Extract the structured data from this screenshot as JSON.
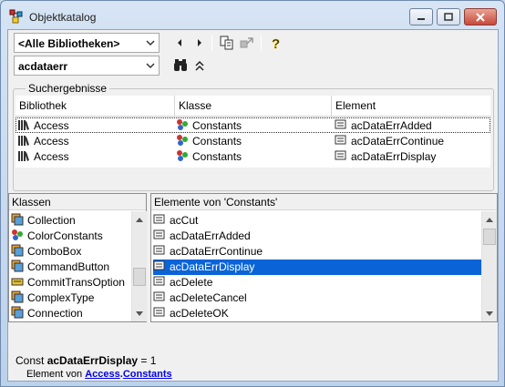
{
  "window": {
    "title": "Objektkatalog"
  },
  "toolbar": {
    "library_value": "<Alle Bibliotheken>",
    "search_value": "acdataerr"
  },
  "results": {
    "group_label": "Suchergebnisse",
    "columns": [
      "Bibliothek",
      "Klasse",
      "Element"
    ],
    "rows": [
      {
        "library": "Access",
        "class": "Constants",
        "element": "acDataErrAdded"
      },
      {
        "library": "Access",
        "class": "Constants",
        "element": "acDataErrContinue"
      },
      {
        "library": "Access",
        "class": "Constants",
        "element": "acDataErrDisplay"
      }
    ]
  },
  "classes": {
    "header": "Klassen",
    "items": [
      "Collection",
      "ColorConstants",
      "ComboBox",
      "CommandButton",
      "CommitTransOption",
      "ComplexType",
      "Connection"
    ]
  },
  "members": {
    "header": "Elemente von 'Constants'",
    "items": [
      "acCut",
      "acDataErrAdded",
      "acDataErrContinue",
      "acDataErrDisplay",
      "acDelete",
      "acDeleteCancel",
      "acDeleteOK"
    ],
    "selected": "acDataErrDisplay"
  },
  "details": {
    "prefix": "Const ",
    "name": "acDataErrDisplay",
    "value": " = 1",
    "member_of": "Element von ",
    "library_link": "Access",
    "dot": ".",
    "class_link": "Constants"
  },
  "colors": {
    "selection": "#0a64d8",
    "link": "#0000ee"
  }
}
